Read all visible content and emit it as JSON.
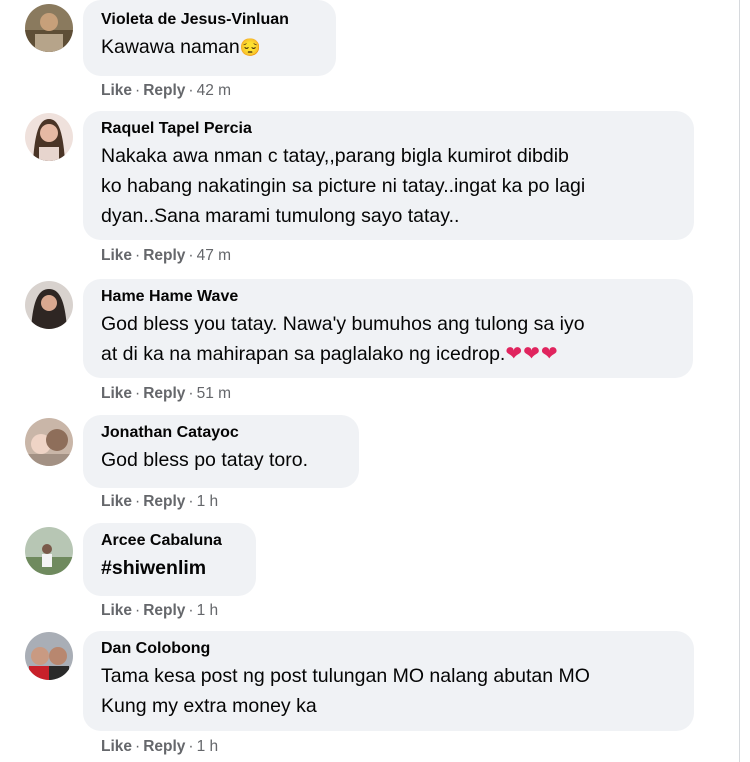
{
  "comments": [
    {
      "author": "Violeta de Jesus-Vinluan",
      "text": "Kawawa naman",
      "emoji": "😔",
      "like": "Like",
      "reply": "Reply",
      "time": "42 m"
    },
    {
      "author": "Raquel Tapel Percia",
      "text": "Nakaka awa nman c tatay,,parang bigla kumirot dibdib\nko habang nakatingin sa picture ni tatay..ingat ka po lagi\ndyan..Sana marami tumulong sayo tatay..",
      "like": "Like",
      "reply": "Reply",
      "time": "47 m"
    },
    {
      "author": "Hame Hame Wave",
      "text": "God bless you tatay. Nawa'y bumuhos ang tulong sa iyo\nat di ka na mahirapan sa paglalako ng icedrop.",
      "emoji": "❤❤❤",
      "like": "Like",
      "reply": "Reply",
      "time": "51 m"
    },
    {
      "author": "Jonathan Catayoc",
      "text": "God bless po tatay toro.",
      "like": "Like",
      "reply": "Reply",
      "time": "1 h"
    },
    {
      "author": "Arcee Cabaluna",
      "text": "#shiwenlim",
      "like": "Like",
      "reply": "Reply",
      "time": "1 h"
    },
    {
      "author": "Dan Colobong",
      "text": "Tama kesa post ng post tulungan MO nalang abutan MO\nKung my extra money ka",
      "like": "Like",
      "reply": "Reply",
      "time": "1 h"
    }
  ],
  "dot": "·"
}
